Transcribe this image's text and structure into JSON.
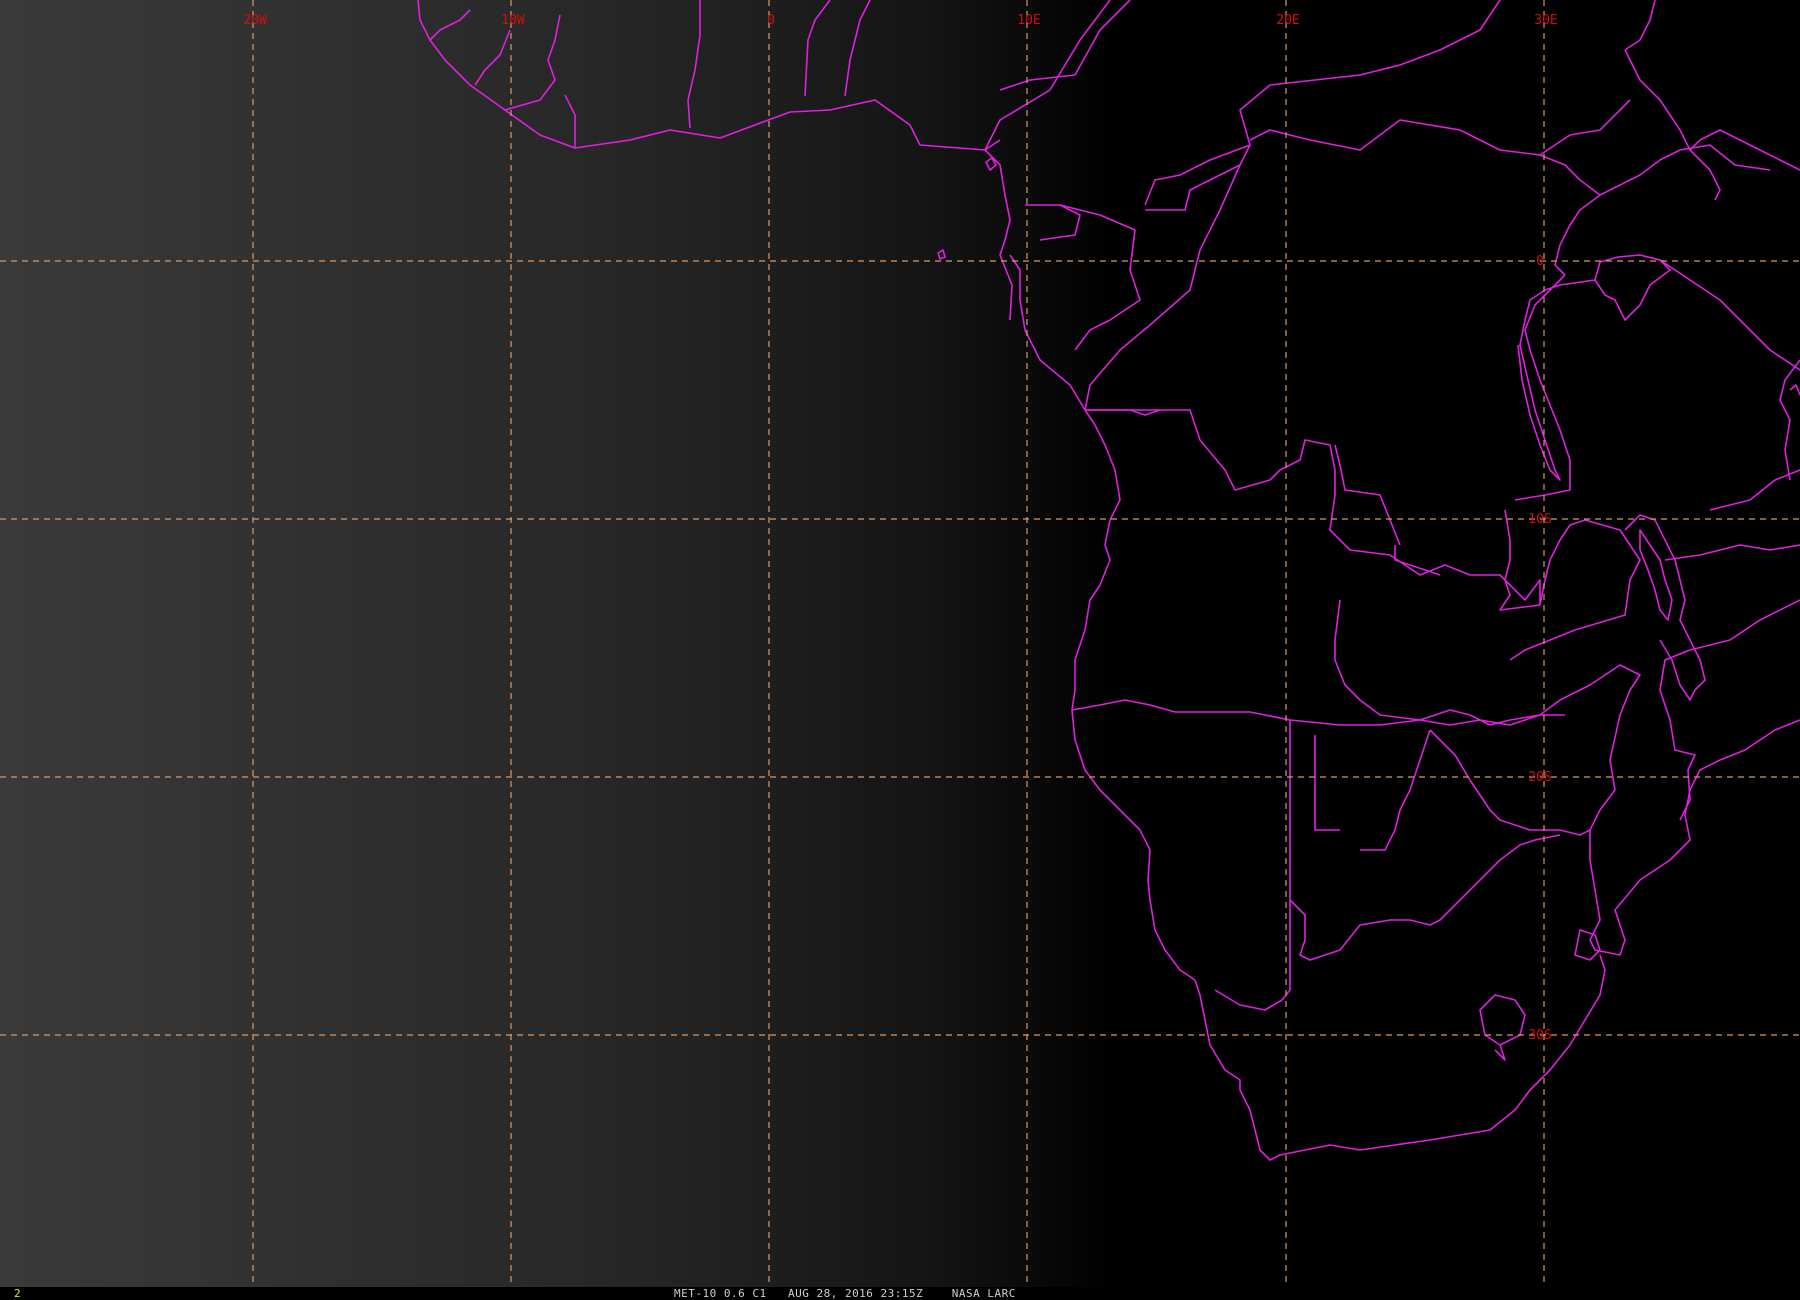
{
  "map": {
    "background_gradient": {
      "left": "#3a3a3a",
      "mid": "#141414",
      "right": "#000000"
    },
    "grid_color": "#d89a6a",
    "label_color": "#d01010",
    "border_color": "#e020e0",
    "longitude_labels": [
      "20W",
      "10W",
      "0",
      "10E",
      "20E",
      "30E"
    ],
    "latitude_labels": [
      "0",
      "10S",
      "20S",
      "30S"
    ]
  },
  "status_bar": {
    "frame_number": "2",
    "caption": "MET-10 0.6 C1   AUG 28, 2016 23:15Z    NASA LARC",
    "frame_color": "#e8e030",
    "caption_color": "#cfcfcf"
  }
}
